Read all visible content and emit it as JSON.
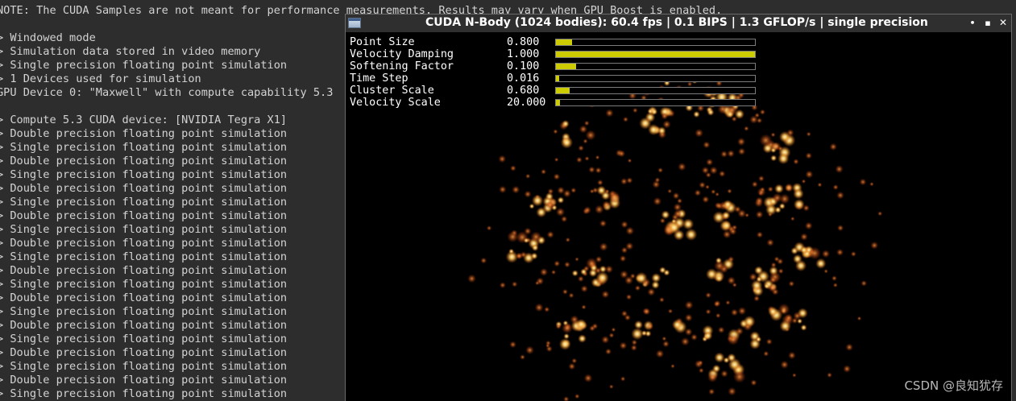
{
  "terminal": {
    "lines": [
      "NOTE: The CUDA Samples are not meant for performance measurements. Results may vary when GPU Boost is enabled.",
      "",
      "> Windowed mode",
      "> Simulation data stored in video memory",
      "> Single precision floating point simulation",
      "> 1 Devices used for simulation",
      "GPU Device 0: \"Maxwell\" with compute capability 5.3",
      "",
      "> Compute 5.3 CUDA device: [NVIDIA Tegra X1]",
      "> Double precision floating point simulation",
      "> Single precision floating point simulation",
      "> Double precision floating point simulation",
      "> Single precision floating point simulation",
      "> Double precision floating point simulation",
      "> Single precision floating point simulation",
      "> Double precision floating point simulation",
      "> Single precision floating point simulation",
      "> Double precision floating point simulation",
      "> Single precision floating point simulation",
      "> Double precision floating point simulation",
      "> Single precision floating point simulation",
      "> Double precision floating point simulation",
      "> Single precision floating point simulation",
      "> Double precision floating point simulation",
      "> Single precision floating point simulation",
      "> Double precision floating point simulation",
      "> Single precision floating point simulation",
      "> Double precision floating point simulation",
      "> Single precision floating point simulation"
    ]
  },
  "window": {
    "title": "CUDA N-Body (1024 bodies): 60.4 fps | 0.1 BIPS | 1.3 GFLOP/s | single precision",
    "icon": "app-window-icon",
    "controls": {
      "minimize": "•",
      "maximize": "▪",
      "close": "✕"
    }
  },
  "params": [
    {
      "label": "Point Size",
      "value": "0.800",
      "fraction": 0.08
    },
    {
      "label": "Velocity Damping",
      "value": "1.000",
      "fraction": 1.0
    },
    {
      "label": "Softening Factor",
      "value": "0.100",
      "fraction": 0.1
    },
    {
      "label": "Time Step",
      "value": "0.016",
      "fraction": 0.016
    },
    {
      "label": "Cluster Scale",
      "value": "0.680",
      "fraction": 0.068
    },
    {
      "label": "Velocity Scale",
      "value": "20.000",
      "fraction": 0.02
    }
  ],
  "colors": {
    "slider_fill": "#cccc00",
    "particle_core": "#fff3b0",
    "particle_glow": "#ff9a2a",
    "particle_dim": "#c25b1c"
  },
  "watermark": "CSDN @良知犹存"
}
